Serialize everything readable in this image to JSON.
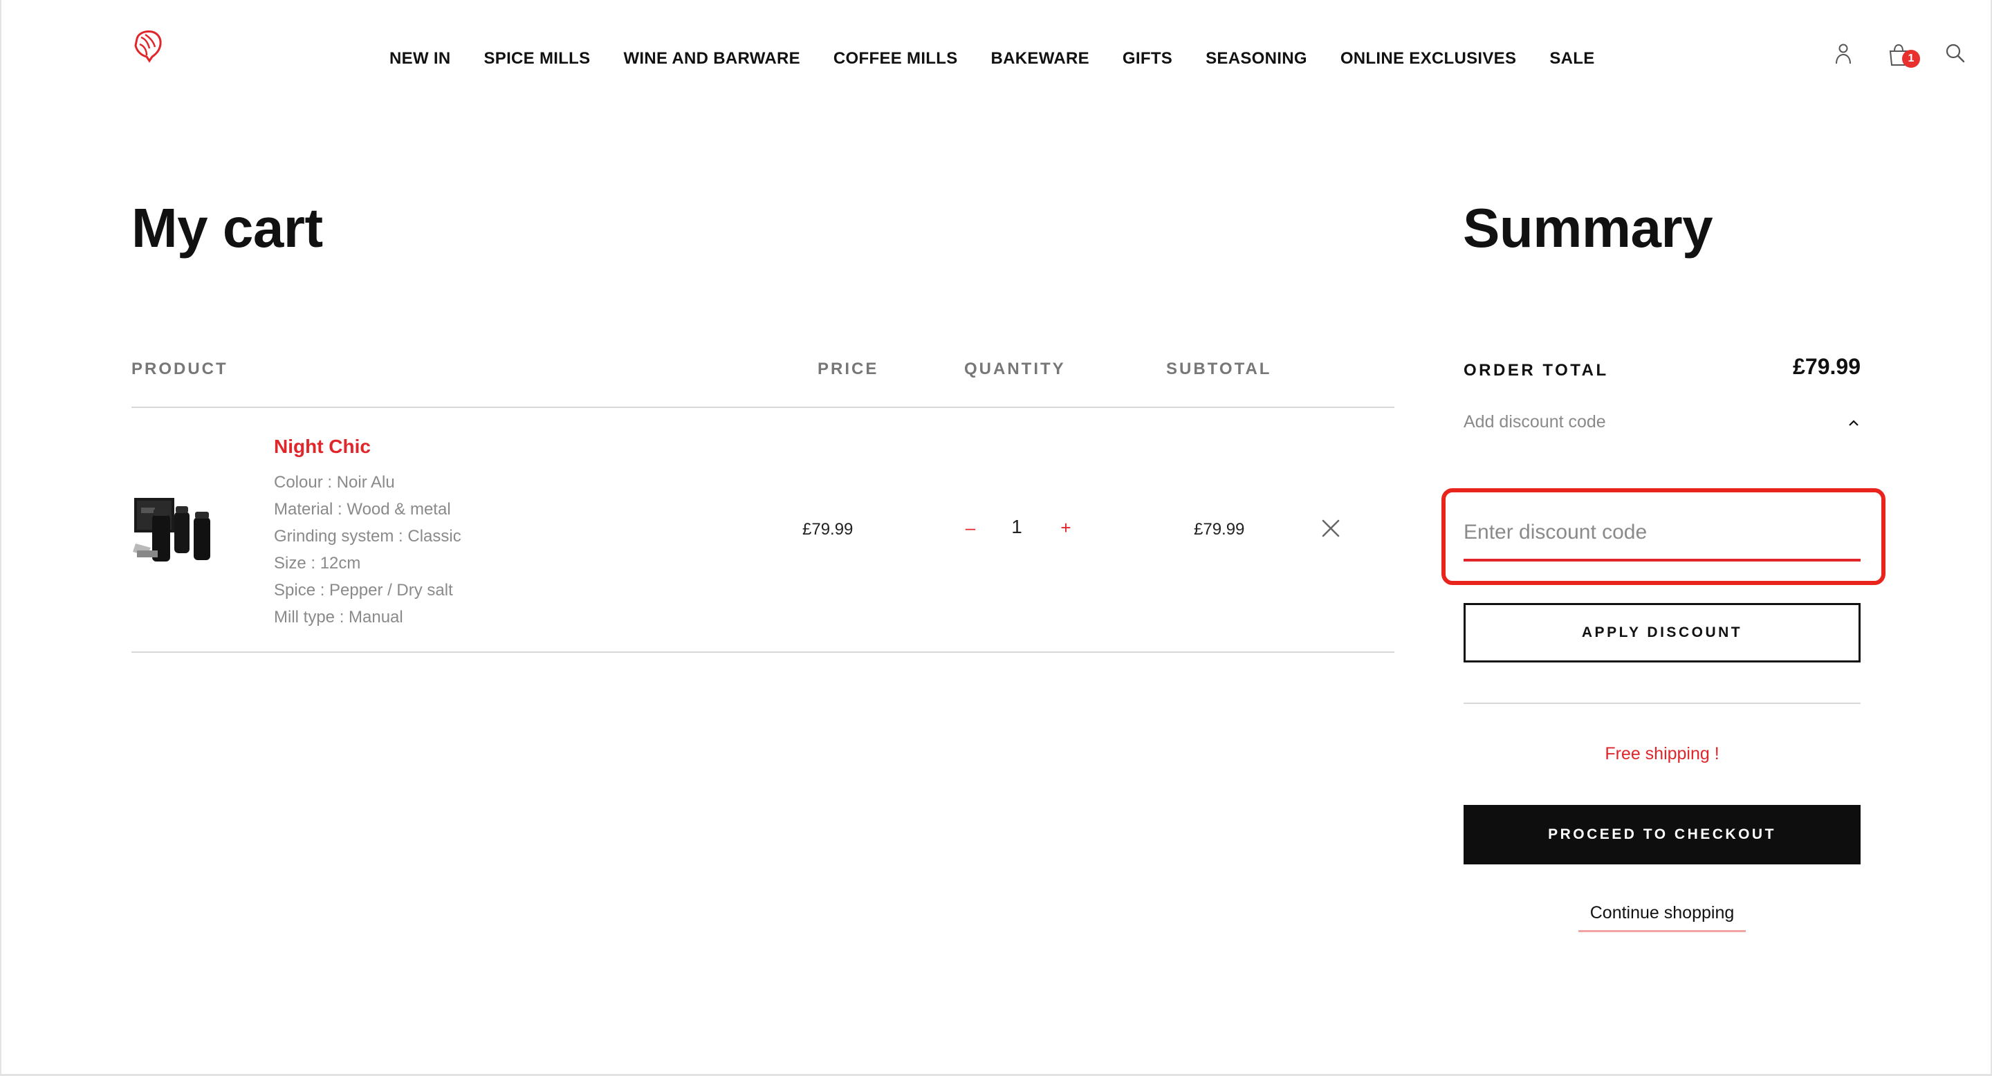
{
  "header": {
    "logo_icon": "lion-head-logo-icon",
    "nav": [
      "NEW IN",
      "SPICE MILLS",
      "WINE AND BARWARE",
      "COFFEE MILLS",
      "BAKEWARE",
      "GIFTS",
      "SEASONING",
      "ONLINE EXCLUSIVES",
      "SALE"
    ],
    "icons": {
      "account": "user-icon",
      "cart": "shopping-bag-icon",
      "search": "search-icon"
    },
    "cart_count": "1"
  },
  "cart": {
    "title": "My cart",
    "columns": {
      "product": "PRODUCT",
      "price": "PRICE",
      "quantity": "QUANTITY",
      "subtotal": "SUBTOTAL"
    },
    "items": [
      {
        "name": "Night Chic",
        "attributes": [
          "Colour : Noir Alu",
          "Material : Wood & metal",
          "Grinding system : Classic",
          "Size : 12cm",
          "Spice : Pepper / Dry salt",
          "Mill type : Manual"
        ],
        "price": "£79.99",
        "quantity": "1",
        "minus": "–",
        "plus": "+",
        "subtotal": "£79.99"
      }
    ]
  },
  "summary": {
    "title": "Summary",
    "order_total_label": "ORDER TOTAL",
    "order_total_value": "£79.99",
    "discount_toggle_label": "Add discount code",
    "discount_placeholder": "Enter discount code",
    "discount_value": "",
    "apply_button": "APPLY DISCOUNT",
    "free_shipping": "Free shipping !",
    "checkout_button": "PROCEED TO CHECKOUT",
    "continue_link": "Continue shopping"
  },
  "colors": {
    "accent": "#e0262a",
    "highlight": "#e8241d",
    "dark": "#0e0e0e",
    "muted": "#8a8a8a"
  }
}
